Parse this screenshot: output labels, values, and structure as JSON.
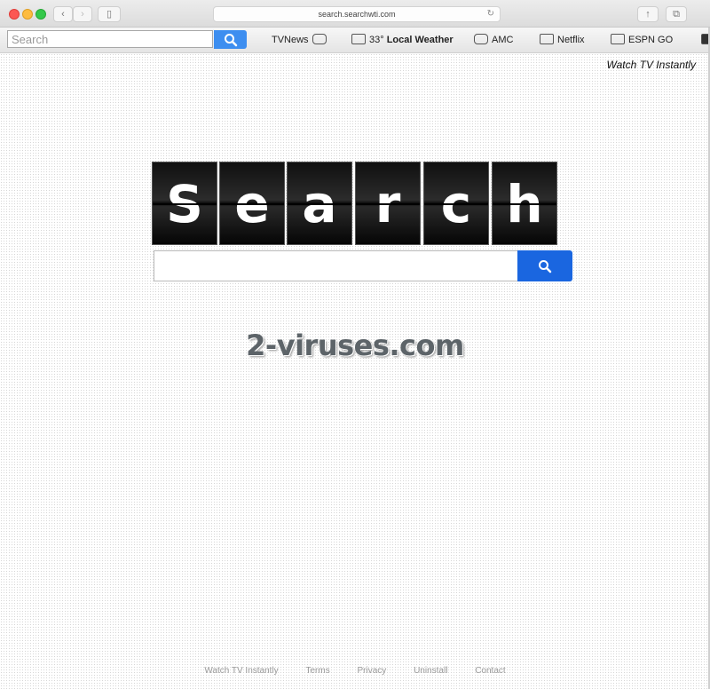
{
  "browser": {
    "url": "search.searchwti.com"
  },
  "toolbar": {
    "search_placeholder": "Search",
    "links": {
      "tvnews": "TVNews",
      "weather_temp": "33°",
      "weather_label": "Local Weather",
      "amc": "AMC",
      "netflix": "Netflix",
      "espngo": "ESPN GO"
    }
  },
  "page": {
    "tagline": "Watch TV Instantly",
    "logo_letters": [
      "S",
      "e",
      "a",
      "r",
      "c",
      "h"
    ],
    "watermark": "2-viruses.com"
  },
  "footer": {
    "links": [
      "Watch TV Instantly",
      "Terms",
      "Privacy",
      "Uninstall",
      "Contact"
    ]
  },
  "colors": {
    "search_button": "#1a66e0",
    "toolbar_button": "#3d8ef0"
  }
}
